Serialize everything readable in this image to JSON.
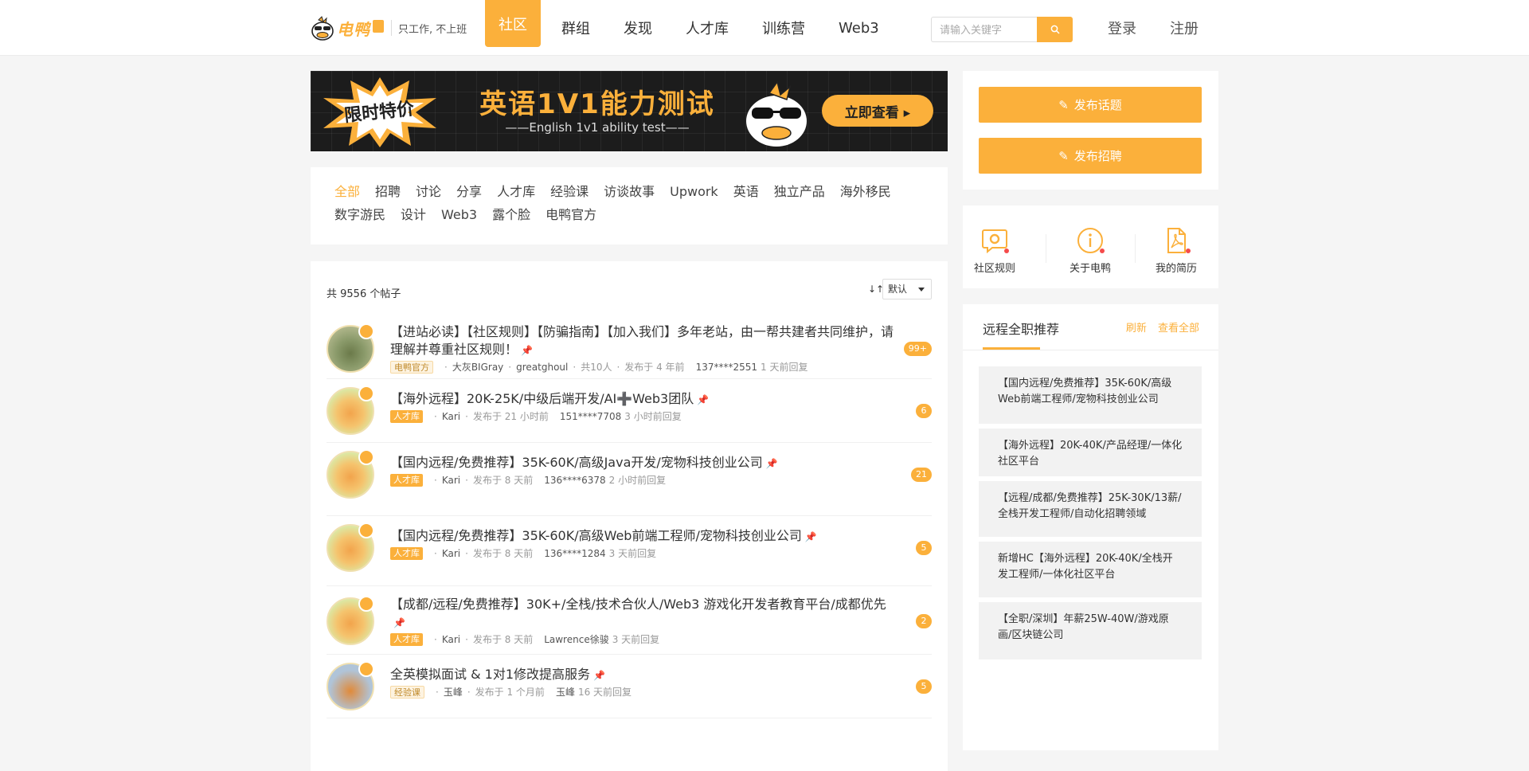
{
  "header": {
    "logo_text": "电鸭",
    "slogan": "只工作, 不上班",
    "nav": [
      "社区",
      "群组",
      "发现",
      "人才库",
      "训练营",
      "Web3"
    ],
    "active_nav": "社区",
    "search_placeholder": "请输入关键字",
    "login": "登录",
    "register": "注册"
  },
  "banner": {
    "badge": "限时特价",
    "title": "英语1V1能力测试",
    "subtitle": "——English 1v1 ability test——",
    "cta": "立即查看 ▸"
  },
  "categories": [
    "全部",
    "招聘",
    "讨论",
    "分享",
    "人才库",
    "经验课",
    "访谈故事",
    "Upwork",
    "英语",
    "独立产品",
    "海外移民",
    "数字游民",
    "设计",
    "Web3",
    "露个脸",
    "电鸭官方"
  ],
  "posts_header": {
    "count_text": "共 9556 个帖子",
    "sort_icon": "↓↑",
    "sort_value": "默认"
  },
  "posts": [
    {
      "title": "【进站必读】【社区规则】【防骗指南】【加入我们】多年老站，由一帮共建者共同维护，请理解并尊重社区规则！",
      "pin": "📌",
      "tag": "电鸭官方",
      "author": "大灰BIGray",
      "extra_author": "greatghoul",
      "participants": "共10人",
      "posted": "发布于 4 年前",
      "replier": "137****2551",
      "replied": "1 天前回复",
      "count": "99+"
    },
    {
      "title": "【海外远程】20K-25K/中级后端开发/AI➕Web3团队",
      "pin": "📌",
      "tag": "人才库",
      "author": "Kari",
      "posted": "发布于 21 小时前",
      "replier": "151****7708",
      "replied": "3 小时前回复",
      "count": "6"
    },
    {
      "title": "【国内远程/免费推荐】35K-60K/高级Java开发/宠物科技创业公司",
      "pin": "📌",
      "tag": "人才库",
      "author": "Kari",
      "posted": "发布于 8 天前",
      "replier": "136****6378",
      "replied": "2 小时前回复",
      "count": "21"
    },
    {
      "title": "【国内远程/免费推荐】35K-60K/高级Web前端工程师/宠物科技创业公司",
      "pin": "📌",
      "tag": "人才库",
      "author": "Kari",
      "posted": "发布于 8 天前",
      "replier": "136****1284",
      "replied": "3 天前回复",
      "count": "5"
    },
    {
      "title": "【成都/远程/免费推荐】30K+/全栈/技术合伙人/Web3 游戏化开发者教育平台/成都优先",
      "pin": "📌",
      "tag": "人才库",
      "author": "Kari",
      "posted": "发布于 8 天前",
      "replier": "Lawrence徐骏",
      "replied": "3 天前回复",
      "count": "2"
    },
    {
      "title": "全英模拟面试 & 1对1修改提高服务",
      "pin": "📌",
      "tag": "经验课",
      "author": "玉峰",
      "posted": "发布于 1 个月前",
      "replier": "玉峰",
      "replied": "16 天前回复",
      "count": "5"
    }
  ],
  "sidebar": {
    "publish_topic": "发布话题",
    "publish_job": "发布招聘",
    "quick_links": [
      "社区规则",
      "关于电鸭",
      "我的简历"
    ],
    "rec_title": "远程全职推荐",
    "refresh": "刷新",
    "view_all": "查看全部",
    "recommendations": [
      "【国内远程/免费推荐】35K-60K/高级Web前端工程师/宠物科技创业公司",
      "【海外远程】20K-40K/产品经理/一体化社区平台",
      "【远程/成都/免费推荐】25K-30K/13薪/全栈开发工程师/自动化招聘领域",
      "新增HC【海外远程】20K-40K/全栈开发工程师/一体化社区平台",
      "【全职/深圳】年薪25W-40W/游戏原画/区块链公司"
    ]
  },
  "colors": {
    "accent": "#fbb03b",
    "background": "#f5f5f5",
    "dot": "#f54b4b"
  }
}
